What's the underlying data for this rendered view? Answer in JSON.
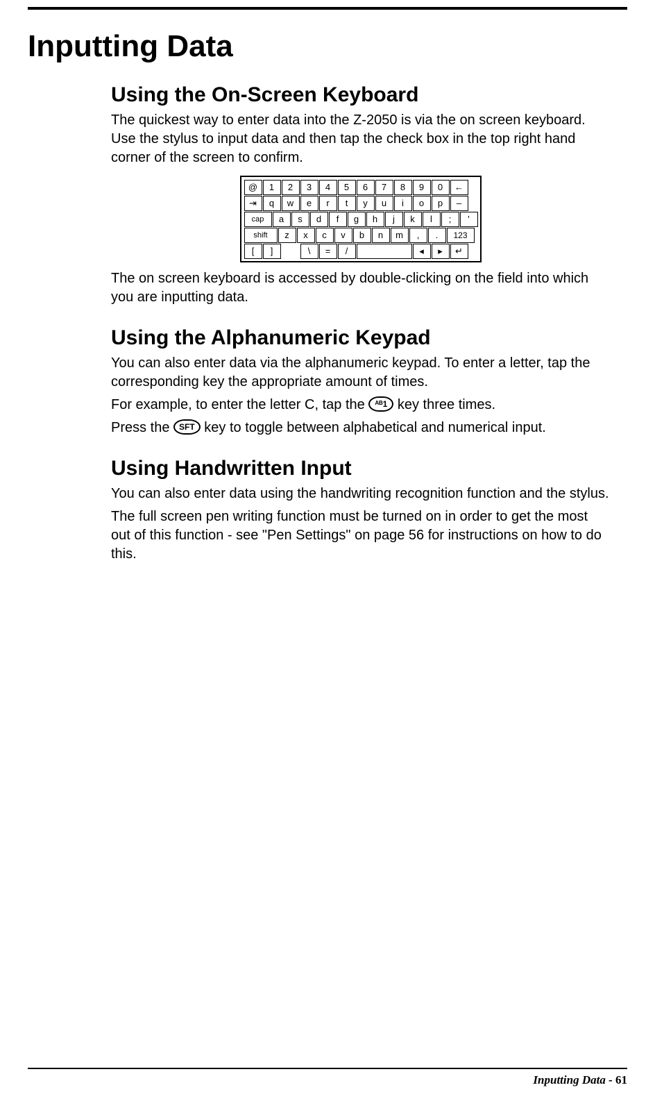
{
  "title": "Inputting Data",
  "sections": {
    "onscreen": {
      "heading": "Using the On-Screen Keyboard",
      "para1": "The quickest way to enter data into the Z-2050 is via the on screen keyboard. Use the stylus to input data and then tap the check box in the top right hand corner of the screen to confirm.",
      "para2": "The on screen keyboard is accessed by double-clicking on the field into which you are inputting data."
    },
    "keypad": {
      "heading": "Using the Alphanumeric Keypad",
      "para1": "You can also enter data via the alphanumeric keypad. To enter a letter, tap the corresponding key the appropriate amount of times.",
      "para2_pre": "For example, to enter the letter C, tap the ",
      "para2_key": "ᴬᴮ1",
      "para2_post": " key three times.",
      "para3_pre": "Press the ",
      "para3_key": "SFT",
      "para3_post": " key to toggle between alphabetical and numerical input."
    },
    "hand": {
      "heading": "Using Handwritten Input",
      "para1": "You can also enter data using the handwriting recognition function and the stylus.",
      "para2": "The full screen pen writing function must be turned on in order to get the most out of this function - see \"Pen Settings\" on page 56 for instructions on how to do this."
    }
  },
  "keyboard": {
    "row1": [
      "@",
      "1",
      "2",
      "3",
      "4",
      "5",
      "6",
      "7",
      "8",
      "9",
      "0",
      "←"
    ],
    "row2": [
      "⇥",
      "q",
      "w",
      "e",
      "r",
      "t",
      "y",
      "u",
      "i",
      "o",
      "p",
      "–"
    ],
    "row3_lead": "cap",
    "row3": [
      "a",
      "s",
      "d",
      "f",
      "g",
      "h",
      "j",
      "k",
      "l",
      ";",
      "'"
    ],
    "row4_lead": "shift",
    "row4": [
      "z",
      "x",
      "c",
      "v",
      "b",
      "n",
      "m",
      ",",
      "."
    ],
    "row4_trail": "123",
    "row5": [
      "[",
      "]",
      "",
      "\\",
      "=",
      "/"
    ],
    "row5_special": [
      "◂",
      "▸",
      "↵"
    ]
  },
  "footer": {
    "section": "Inputting Data",
    "page": "61"
  }
}
